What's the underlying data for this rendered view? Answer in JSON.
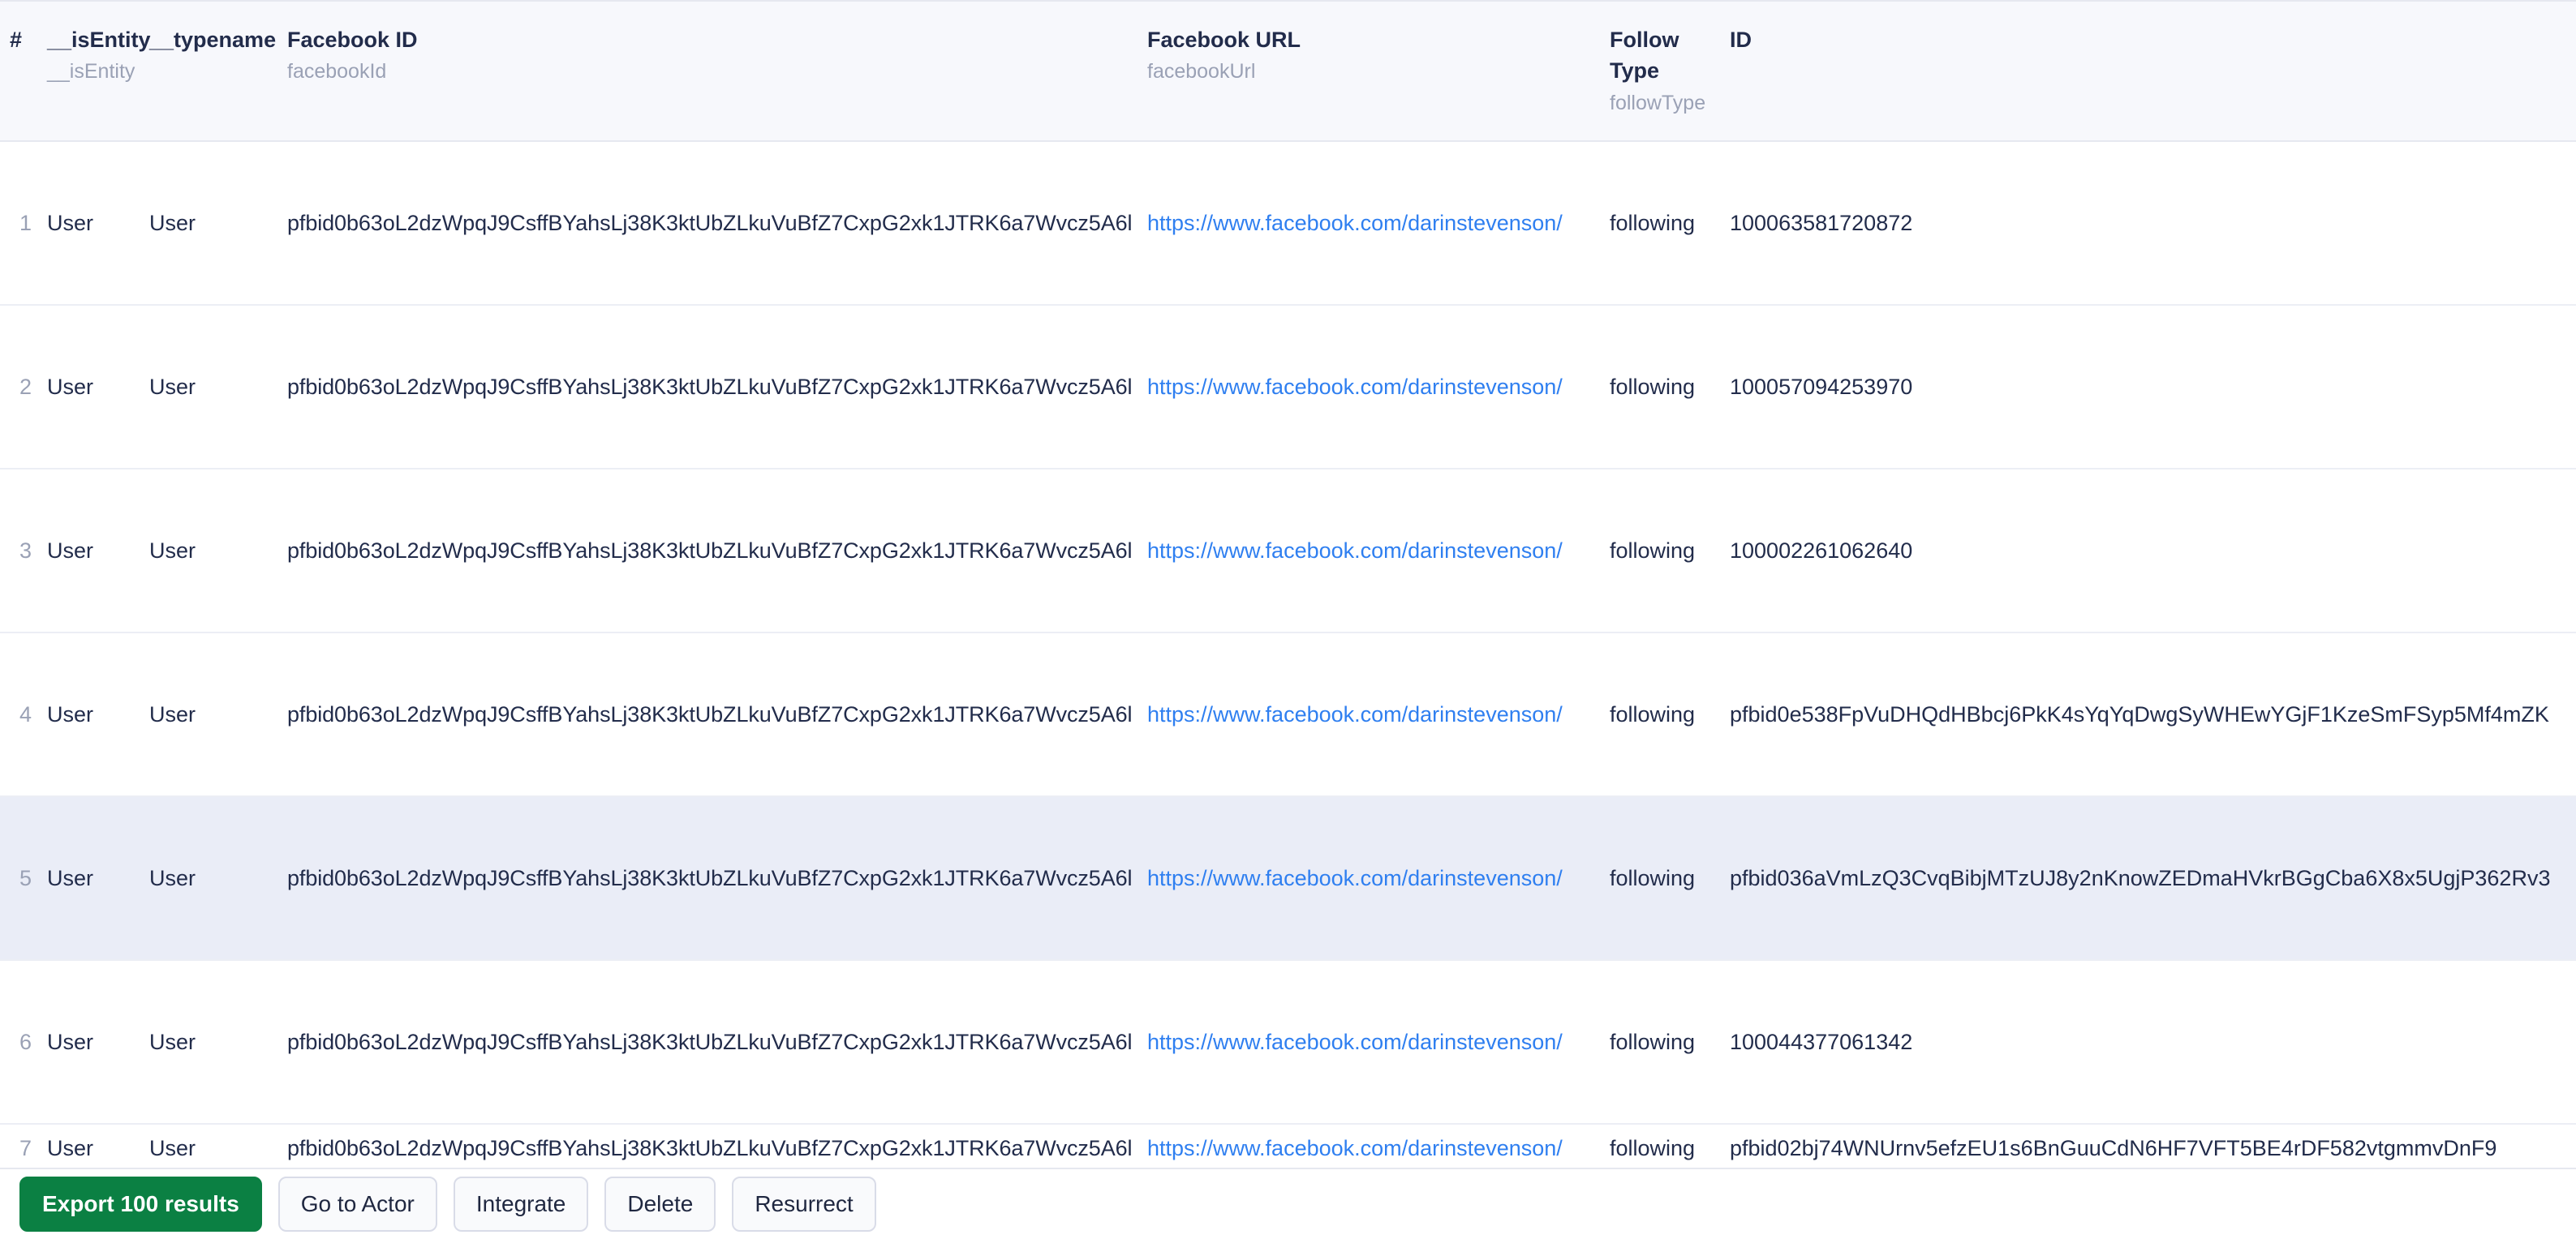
{
  "table": {
    "columns": [
      {
        "label": "#",
        "field": "",
        "key": "num"
      },
      {
        "label": "__isEntity",
        "field": "__isEntity",
        "key": "isEntity"
      },
      {
        "label": "__typename",
        "field": "",
        "key": "typename"
      },
      {
        "label": "Facebook ID",
        "field": "facebookId",
        "key": "facebookId"
      },
      {
        "label": "Facebook URL",
        "field": "facebookUrl",
        "key": "facebookUrl"
      },
      {
        "label": "Follow Type",
        "field": "followType",
        "key": "followType"
      },
      {
        "label": "ID",
        "field": "",
        "key": "id"
      }
    ],
    "rows": [
      {
        "num": "1",
        "isEntity": "User",
        "typename": "User",
        "facebookId": "pfbid0b63oL2dzWpqJ9CsffBYahsLj38K3ktUbZLkuVuBfZ7CxpG2xk1JTRK6a7Wvcz5A6l",
        "facebookUrl": "https://www.facebook.com/darinstevenson/",
        "followType": "following",
        "id": "100063581720872"
      },
      {
        "num": "2",
        "isEntity": "User",
        "typename": "User",
        "facebookId": "pfbid0b63oL2dzWpqJ9CsffBYahsLj38K3ktUbZLkuVuBfZ7CxpG2xk1JTRK6a7Wvcz5A6l",
        "facebookUrl": "https://www.facebook.com/darinstevenson/",
        "followType": "following",
        "id": "100057094253970"
      },
      {
        "num": "3",
        "isEntity": "User",
        "typename": "User",
        "facebookId": "pfbid0b63oL2dzWpqJ9CsffBYahsLj38K3ktUbZLkuVuBfZ7CxpG2xk1JTRK6a7Wvcz5A6l",
        "facebookUrl": "https://www.facebook.com/darinstevenson/",
        "followType": "following",
        "id": "100002261062640"
      },
      {
        "num": "4",
        "isEntity": "User",
        "typename": "User",
        "facebookId": "pfbid0b63oL2dzWpqJ9CsffBYahsLj38K3ktUbZLkuVuBfZ7CxpG2xk1JTRK6a7Wvcz5A6l",
        "facebookUrl": "https://www.facebook.com/darinstevenson/",
        "followType": "following",
        "id": "pfbid0e538FpVuDHQdHBbcj6PkK4sYqYqDwgSyWHEwYGjF1KzeSmFSyp5Mf4mZK"
      },
      {
        "num": "5",
        "isEntity": "User",
        "typename": "User",
        "facebookId": "pfbid0b63oL2dzWpqJ9CsffBYahsLj38K3ktUbZLkuVuBfZ7CxpG2xk1JTRK6a7Wvcz5A6l",
        "facebookUrl": "https://www.facebook.com/darinstevenson/",
        "followType": "following",
        "id": "pfbid036aVmLzQ3CvqBibjMTzUJ8y2nKnowZEDmaHVkrBGgCba6X8x5UgjP362Rv3",
        "highlighted": true
      },
      {
        "num": "6",
        "isEntity": "User",
        "typename": "User",
        "facebookId": "pfbid0b63oL2dzWpqJ9CsffBYahsLj38K3ktUbZLkuVuBfZ7CxpG2xk1JTRK6a7Wvcz5A6l",
        "facebookUrl": "https://www.facebook.com/darinstevenson/",
        "followType": "following",
        "id": "100044377061342"
      },
      {
        "num": "7",
        "isEntity": "User",
        "typename": "User",
        "facebookId": "pfbid0b63oL2dzWpqJ9CsffBYahsLj38K3ktUbZLkuVuBfZ7CxpG2xk1JTRK6a7Wvcz5A6l",
        "facebookUrl": "https://www.facebook.com/darinstevenson/",
        "followType": "following",
        "id": "pfbid02bj74WNUrnv5efzEU1s6BnGuuCdN6HF7VFT5BE4rDF582vtgmmvDnF9",
        "clipped": true
      }
    ]
  },
  "toolbar": {
    "buttons": [
      {
        "label": "Export 100 results",
        "style": "primary",
        "name": "export-results-button"
      },
      {
        "label": "Go to Actor",
        "style": "default",
        "name": "go-to-actor-button"
      },
      {
        "label": "Integrate",
        "style": "default",
        "name": "integrate-button"
      },
      {
        "label": "Delete",
        "style": "default",
        "name": "delete-button"
      },
      {
        "label": "Resurrect",
        "style": "default",
        "name": "resurrect-button"
      }
    ]
  },
  "colors": {
    "primary": "#0b8043",
    "link": "#2f7ff0",
    "header_bg": "#f7f8fc",
    "row_highlight": "#eaedf7",
    "text": "#222c4b",
    "muted": "#9aa1b5"
  }
}
